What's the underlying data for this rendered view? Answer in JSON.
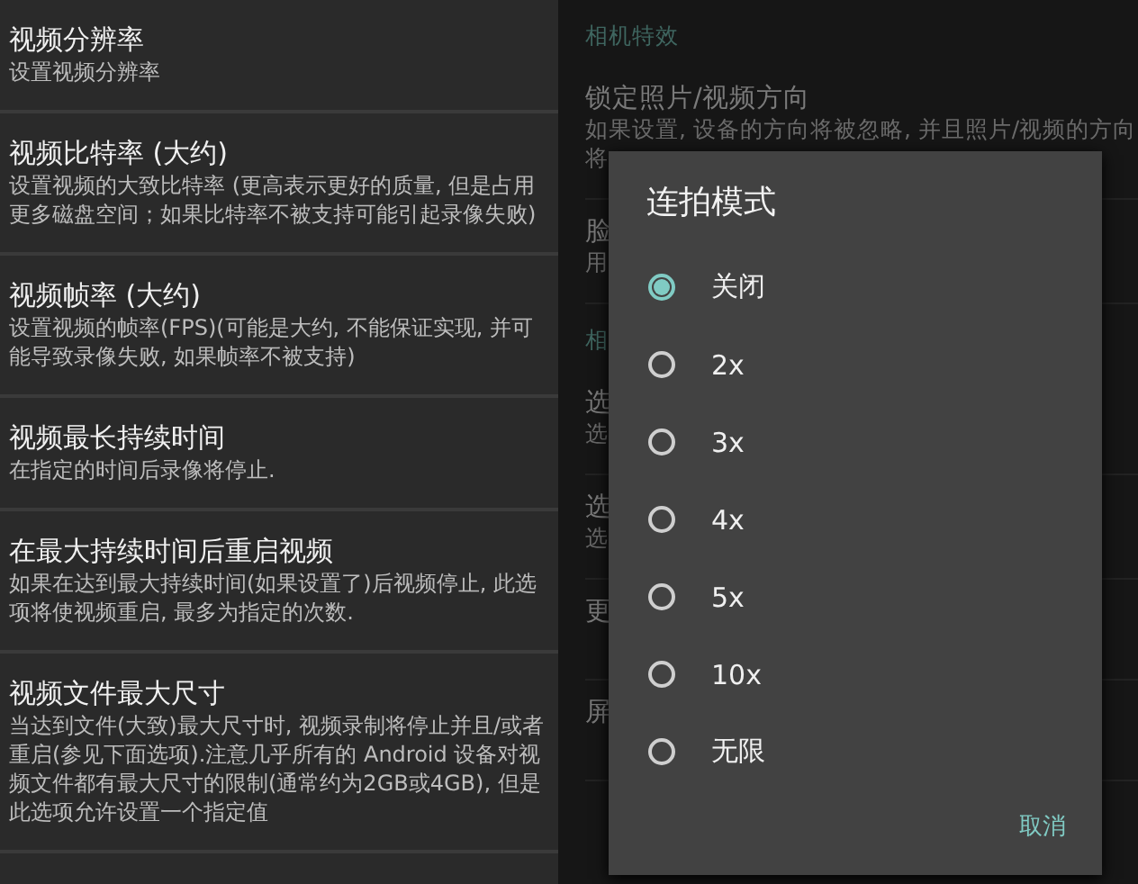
{
  "settings": [
    {
      "title": "视频分辨率",
      "summary": "设置视频分辨率"
    },
    {
      "title": "视频比特率 (大约)",
      "summary": "设置视频的大致比特率 (更高表示更好的质量, 但是占用更多磁盘空间；如果比特率不被支持可能引起录像失败)"
    },
    {
      "title": "视频帧率 (大约)",
      "summary": "设置视频的帧率(FPS)(可能是大约, 不能保证实现, 并可能导致录像失败, 如果帧率不被支持)"
    },
    {
      "title": "视频最长持续时间",
      "summary": "在指定的时间后录像将停止."
    },
    {
      "title": "在最大持续时间后重启视频",
      "summary": "如果在达到最大持续时间(如果设置了)后视频停止, 此选项将使视频重启, 最多为指定的次数."
    },
    {
      "title": "视频文件最大尺寸",
      "summary": "当达到文件(大致)最大尺寸时, 视频录制将停止并且/或者重启(参见下面选项).注意几乎所有的 Android 设备对视频文件都有最大尺寸的限制(通常约为2GB或4GB), 但是此选项允许设置一个指定值"
    }
  ],
  "background": [
    {
      "kind": "category",
      "title": "相机特效"
    },
    {
      "kind": "item",
      "title": "锁定照片/视频方向",
      "summary_lines": [
        "如果设置, 设备的方向将被忽略, 并且照片/视频的方向",
        "将"
      ]
    },
    {
      "kind": "item",
      "title": "脸",
      "summary_lines": [
        "用"
      ]
    },
    {
      "kind": "category",
      "title": "相"
    },
    {
      "kind": "item",
      "title": "选",
      "summary_lines": [
        "选"
      ]
    },
    {
      "kind": "item",
      "title": "选",
      "summary_lines": [
        "选"
      ]
    },
    {
      "kind": "item",
      "title": "更"
    },
    {
      "kind": "item",
      "title": "屏"
    }
  ],
  "dialog": {
    "title": "连拍模式",
    "options": [
      {
        "label": "关闭",
        "selected": true
      },
      {
        "label": "2x",
        "selected": false
      },
      {
        "label": "3x",
        "selected": false
      },
      {
        "label": "4x",
        "selected": false
      },
      {
        "label": "5x",
        "selected": false
      },
      {
        "label": "10x",
        "selected": false
      },
      {
        "label": "无限",
        "selected": false
      }
    ],
    "cancel": "取消"
  }
}
